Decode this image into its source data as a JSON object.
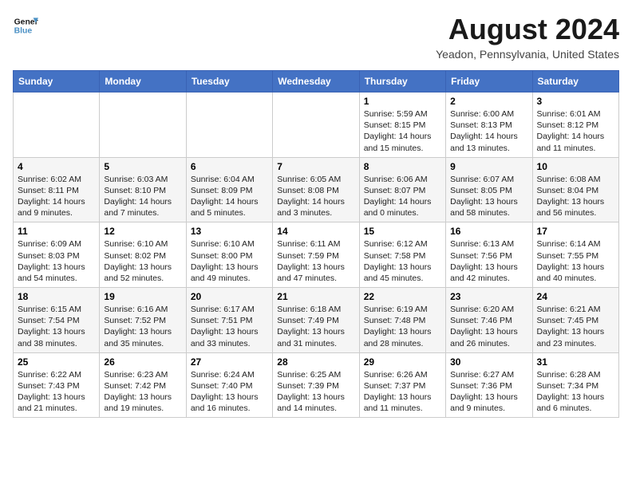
{
  "header": {
    "logo_general": "General",
    "logo_blue": "Blue",
    "month_year": "August 2024",
    "location": "Yeadon, Pennsylvania, United States"
  },
  "weekdays": [
    "Sunday",
    "Monday",
    "Tuesday",
    "Wednesday",
    "Thursday",
    "Friday",
    "Saturday"
  ],
  "weeks": [
    [
      {
        "day": "",
        "content": ""
      },
      {
        "day": "",
        "content": ""
      },
      {
        "day": "",
        "content": ""
      },
      {
        "day": "",
        "content": ""
      },
      {
        "day": "1",
        "content": "Sunrise: 5:59 AM\nSunset: 8:15 PM\nDaylight: 14 hours\nand 15 minutes."
      },
      {
        "day": "2",
        "content": "Sunrise: 6:00 AM\nSunset: 8:13 PM\nDaylight: 14 hours\nand 13 minutes."
      },
      {
        "day": "3",
        "content": "Sunrise: 6:01 AM\nSunset: 8:12 PM\nDaylight: 14 hours\nand 11 minutes."
      }
    ],
    [
      {
        "day": "4",
        "content": "Sunrise: 6:02 AM\nSunset: 8:11 PM\nDaylight: 14 hours\nand 9 minutes."
      },
      {
        "day": "5",
        "content": "Sunrise: 6:03 AM\nSunset: 8:10 PM\nDaylight: 14 hours\nand 7 minutes."
      },
      {
        "day": "6",
        "content": "Sunrise: 6:04 AM\nSunset: 8:09 PM\nDaylight: 14 hours\nand 5 minutes."
      },
      {
        "day": "7",
        "content": "Sunrise: 6:05 AM\nSunset: 8:08 PM\nDaylight: 14 hours\nand 3 minutes."
      },
      {
        "day": "8",
        "content": "Sunrise: 6:06 AM\nSunset: 8:07 PM\nDaylight: 14 hours\nand 0 minutes."
      },
      {
        "day": "9",
        "content": "Sunrise: 6:07 AM\nSunset: 8:05 PM\nDaylight: 13 hours\nand 58 minutes."
      },
      {
        "day": "10",
        "content": "Sunrise: 6:08 AM\nSunset: 8:04 PM\nDaylight: 13 hours\nand 56 minutes."
      }
    ],
    [
      {
        "day": "11",
        "content": "Sunrise: 6:09 AM\nSunset: 8:03 PM\nDaylight: 13 hours\nand 54 minutes."
      },
      {
        "day": "12",
        "content": "Sunrise: 6:10 AM\nSunset: 8:02 PM\nDaylight: 13 hours\nand 52 minutes."
      },
      {
        "day": "13",
        "content": "Sunrise: 6:10 AM\nSunset: 8:00 PM\nDaylight: 13 hours\nand 49 minutes."
      },
      {
        "day": "14",
        "content": "Sunrise: 6:11 AM\nSunset: 7:59 PM\nDaylight: 13 hours\nand 47 minutes."
      },
      {
        "day": "15",
        "content": "Sunrise: 6:12 AM\nSunset: 7:58 PM\nDaylight: 13 hours\nand 45 minutes."
      },
      {
        "day": "16",
        "content": "Sunrise: 6:13 AM\nSunset: 7:56 PM\nDaylight: 13 hours\nand 42 minutes."
      },
      {
        "day": "17",
        "content": "Sunrise: 6:14 AM\nSunset: 7:55 PM\nDaylight: 13 hours\nand 40 minutes."
      }
    ],
    [
      {
        "day": "18",
        "content": "Sunrise: 6:15 AM\nSunset: 7:54 PM\nDaylight: 13 hours\nand 38 minutes."
      },
      {
        "day": "19",
        "content": "Sunrise: 6:16 AM\nSunset: 7:52 PM\nDaylight: 13 hours\nand 35 minutes."
      },
      {
        "day": "20",
        "content": "Sunrise: 6:17 AM\nSunset: 7:51 PM\nDaylight: 13 hours\nand 33 minutes."
      },
      {
        "day": "21",
        "content": "Sunrise: 6:18 AM\nSunset: 7:49 PM\nDaylight: 13 hours\nand 31 minutes."
      },
      {
        "day": "22",
        "content": "Sunrise: 6:19 AM\nSunset: 7:48 PM\nDaylight: 13 hours\nand 28 minutes."
      },
      {
        "day": "23",
        "content": "Sunrise: 6:20 AM\nSunset: 7:46 PM\nDaylight: 13 hours\nand 26 minutes."
      },
      {
        "day": "24",
        "content": "Sunrise: 6:21 AM\nSunset: 7:45 PM\nDaylight: 13 hours\nand 23 minutes."
      }
    ],
    [
      {
        "day": "25",
        "content": "Sunrise: 6:22 AM\nSunset: 7:43 PM\nDaylight: 13 hours\nand 21 minutes."
      },
      {
        "day": "26",
        "content": "Sunrise: 6:23 AM\nSunset: 7:42 PM\nDaylight: 13 hours\nand 19 minutes."
      },
      {
        "day": "27",
        "content": "Sunrise: 6:24 AM\nSunset: 7:40 PM\nDaylight: 13 hours\nand 16 minutes."
      },
      {
        "day": "28",
        "content": "Sunrise: 6:25 AM\nSunset: 7:39 PM\nDaylight: 13 hours\nand 14 minutes."
      },
      {
        "day": "29",
        "content": "Sunrise: 6:26 AM\nSunset: 7:37 PM\nDaylight: 13 hours\nand 11 minutes."
      },
      {
        "day": "30",
        "content": "Sunrise: 6:27 AM\nSunset: 7:36 PM\nDaylight: 13 hours\nand 9 minutes."
      },
      {
        "day": "31",
        "content": "Sunrise: 6:28 AM\nSunset: 7:34 PM\nDaylight: 13 hours\nand 6 minutes."
      }
    ]
  ]
}
